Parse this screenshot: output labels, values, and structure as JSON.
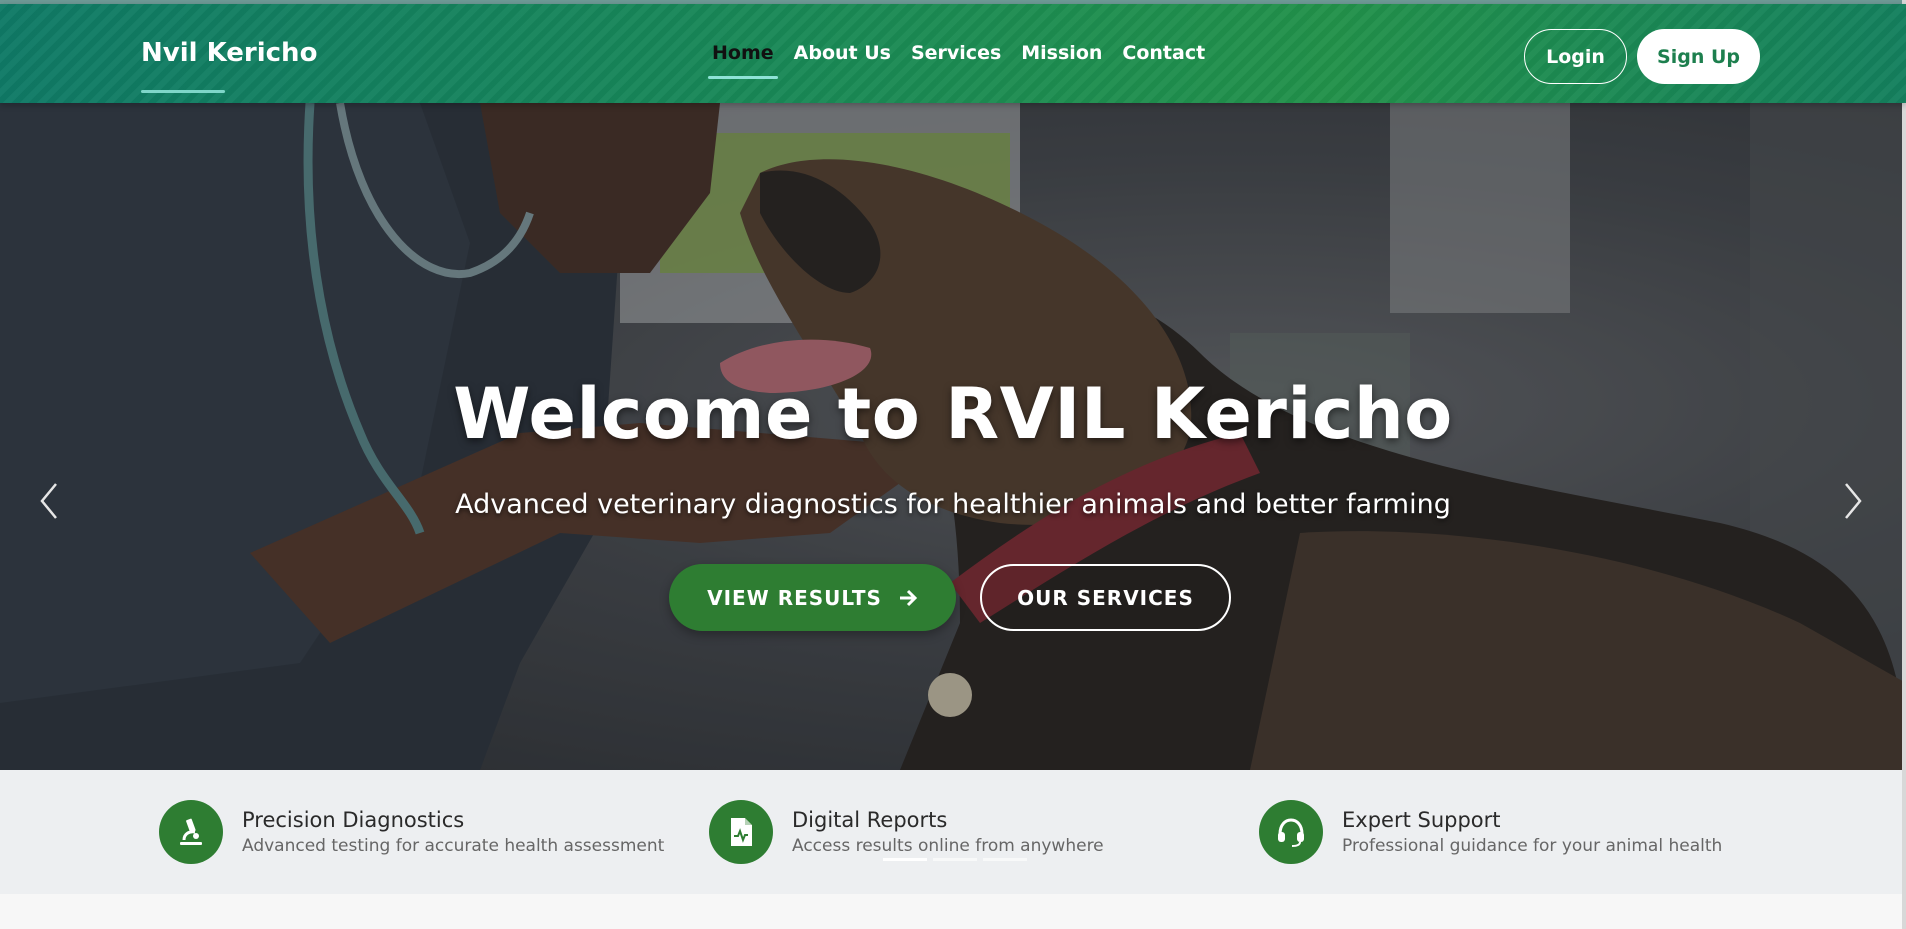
{
  "header": {
    "brand": "Nvil Kericho",
    "nav": [
      {
        "label": "Home",
        "active": true
      },
      {
        "label": "About Us",
        "active": false
      },
      {
        "label": "Services",
        "active": false
      },
      {
        "label": "Mission",
        "active": false
      },
      {
        "label": "Contact",
        "active": false
      }
    ],
    "login_label": "Login",
    "signup_label": "Sign Up"
  },
  "hero": {
    "title": "Welcome to RVIL Kericho",
    "subtitle": "Advanced veterinary diagnostics for healthier animals and better farming",
    "primary_button": "VIEW RESULTS",
    "secondary_button": "OUR SERVICES",
    "prev_icon": "chevron-left-icon",
    "next_icon": "chevron-right-icon",
    "slide_count": 3,
    "active_slide": 1
  },
  "features": [
    {
      "title": "Precision Diagnostics",
      "description": "Advanced testing for accurate health assessment",
      "icon": "microscope-icon"
    },
    {
      "title": "Digital Reports",
      "description": "Access results online from anywhere",
      "icon": "file-medical-icon"
    },
    {
      "title": "Expert Support",
      "description": "Professional guidance for your animal health",
      "icon": "headset-icon"
    }
  ],
  "colors": {
    "header_start": "#0f7a66",
    "header_end": "#22924a",
    "primary_green": "#2e7d32",
    "accent_teal": "#8fe3d7"
  }
}
